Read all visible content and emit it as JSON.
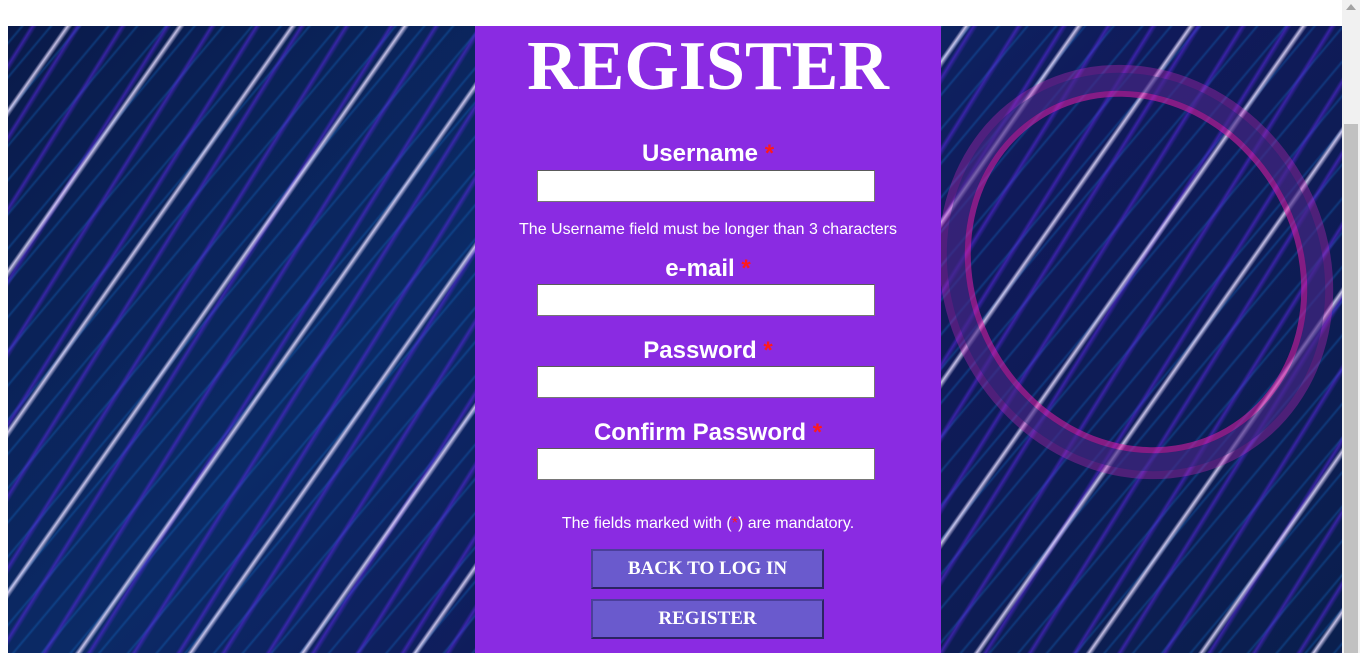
{
  "form": {
    "title": "REGISTER",
    "required_marker": "*",
    "fields": [
      {
        "label": "Username",
        "value": "",
        "placeholder": ""
      },
      {
        "label": "e-mail",
        "value": "",
        "placeholder": ""
      },
      {
        "label": "Password",
        "value": "",
        "placeholder": ""
      },
      {
        "label": "Confirm Password",
        "value": "",
        "placeholder": ""
      }
    ],
    "username_hint": "The Username field must be longer than 3 characters",
    "mandatory_note_prefix": "The fields marked with (",
    "mandatory_note_marker": "*",
    "mandatory_note_suffix": ") are mandatory.",
    "back_button_label": "BACK TO LOG IN",
    "register_button_label": "REGISTER"
  },
  "colors": {
    "panel": "#8a2be2",
    "button": "#6a5acd",
    "required": "#ff1a1a",
    "text": "#ffffff"
  }
}
